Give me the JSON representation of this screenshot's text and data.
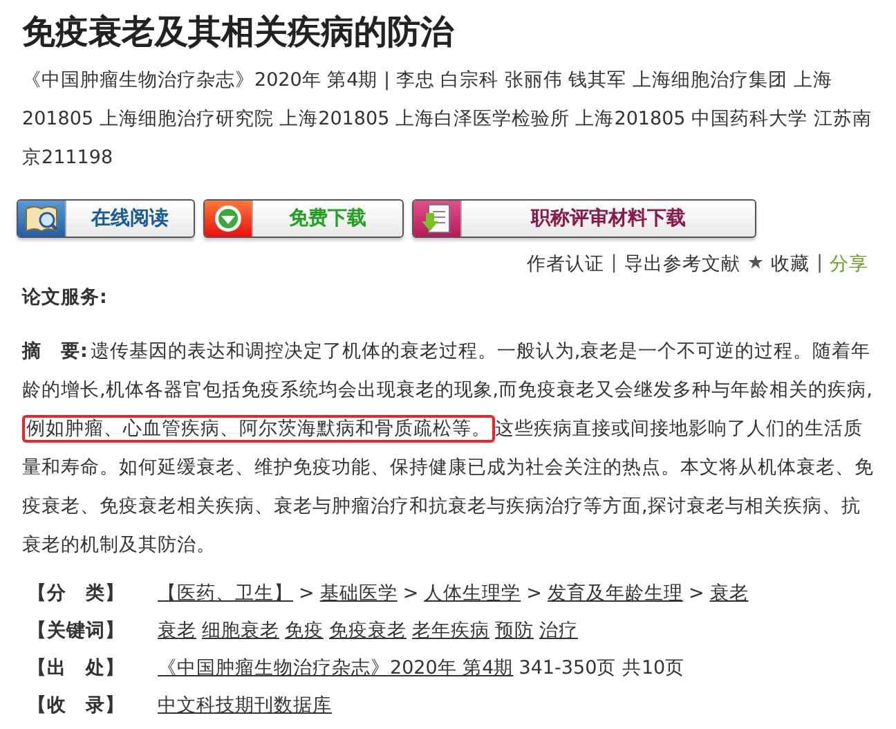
{
  "title": "免疫衰老及其相关疾病的防治",
  "meta": "《中国肿瘤生物治疗杂志》2020年 第4期 | 李忠 白宗科 张丽伟 钱其军   上海细胞治疗集团 上海201805 上海细胞治疗研究院 上海201805 上海白泽医学检验所 上海201805 中国药科大学 江苏南京211198",
  "buttons": [
    {
      "label": "在线阅读",
      "kind": "read"
    },
    {
      "label": "免费下载",
      "kind": "download"
    },
    {
      "label": "职称评审材料下载",
      "kind": "material"
    }
  ],
  "actions": [
    {
      "label": "作者认证",
      "kind": "link"
    },
    {
      "label": "|",
      "kind": "separator"
    },
    {
      "label": "导出参考文献",
      "kind": "link"
    },
    {
      "label": "★",
      "kind": "star"
    },
    {
      "label": "收藏",
      "kind": "link"
    },
    {
      "label": "|",
      "kind": "separator"
    },
    {
      "label": "分享",
      "kind": "share"
    }
  ],
  "services_label": "论文服务:",
  "abstract": {
    "label": "摘　要:",
    "parts": [
      {
        "text": "遗传基因的表达和调控决定了机体的衰老过程。一般认为,衰老是一个不可逆的过程。随着年龄的增长,机体各器官包括免疫系统均会出现衰老的现象,而免疫衰老又会继发多种与年龄相关的疾病,",
        "highlighted": false
      },
      {
        "text": "例如肿瘤、心血管疾病、阿尔茨海默病和骨质疏松等。",
        "highlighted": true
      },
      {
        "text": "这些疾病直接或间接地影响了人们的生活质量和寿命。如何延缓衰老、维护免疫功能、保持健康已成为社会关注的热点。本文将从机体衰老、免疫衰老、免疫衰老相关疾病、衰老与肿瘤治疗和抗衰老与疾病治疗等方面,探讨衰老与相关疾病、抗衰老的机制及其防治。",
        "highlighted": false
      }
    ]
  },
  "info": [
    {
      "label": "【分　类】",
      "items": [
        {
          "text": "【医药、卫生】",
          "kind": "link"
        },
        {
          "text": ">",
          "kind": "text"
        },
        {
          "text": "基础医学",
          "kind": "link"
        },
        {
          "text": ">",
          "kind": "text"
        },
        {
          "text": "人体生理学",
          "kind": "link"
        },
        {
          "text": ">",
          "kind": "text"
        },
        {
          "text": "发育及年龄生理",
          "kind": "link"
        },
        {
          "text": ">",
          "kind": "text"
        },
        {
          "text": "衰老",
          "kind": "link"
        }
      ]
    },
    {
      "label": "【关键词】",
      "items": [
        {
          "text": "衰老",
          "kind": "link"
        },
        {
          "text": "细胞衰老",
          "kind": "link"
        },
        {
          "text": "免疫",
          "kind": "link"
        },
        {
          "text": "免疫衰老",
          "kind": "link"
        },
        {
          "text": "老年疾病",
          "kind": "link"
        },
        {
          "text": "预防",
          "kind": "link"
        },
        {
          "text": "治疗",
          "kind": "link"
        }
      ]
    },
    {
      "label": "【出　处】",
      "items": [
        {
          "text": "《中国肿瘤生物治疗杂志》2020年 第4期",
          "kind": "link"
        },
        {
          "text": "341-350页 共10页",
          "kind": "text"
        }
      ]
    },
    {
      "label": "【收　录】",
      "items": [
        {
          "text": "中文科技期刊数据库",
          "kind": "link"
        }
      ]
    }
  ]
}
